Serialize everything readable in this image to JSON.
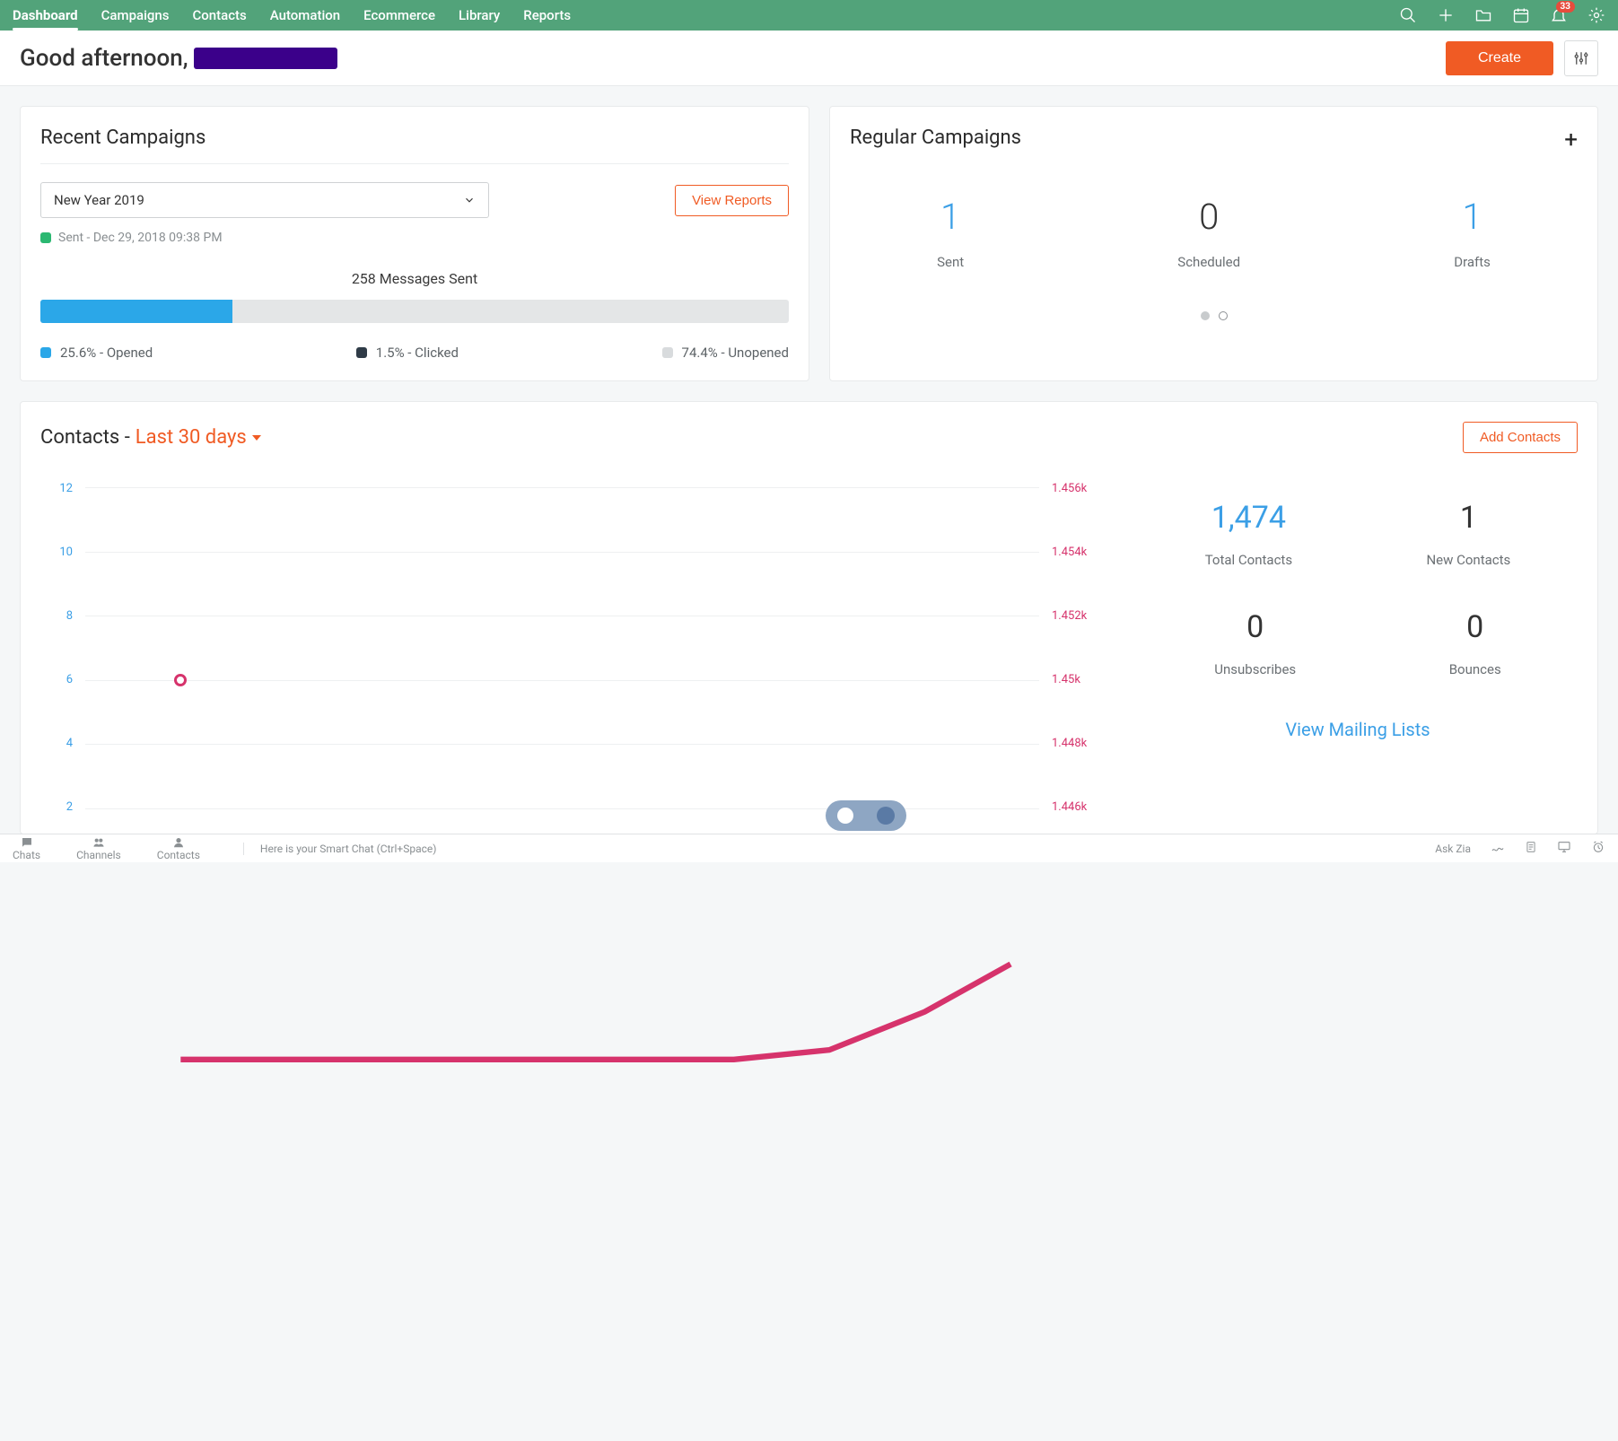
{
  "nav": {
    "items": [
      "Dashboard",
      "Campaigns",
      "Contacts",
      "Automation",
      "Ecommerce",
      "Library",
      "Reports"
    ],
    "active_index": 0
  },
  "notifications": {
    "count": "33"
  },
  "greeting": {
    "prefix": "Good afternoon,"
  },
  "actions": {
    "create": "Create"
  },
  "recent": {
    "title": "Recent Campaigns",
    "selected_campaign": "New Year 2019",
    "view_reports": "View Reports",
    "sent_status": "Sent - Dec 29, 2018 09:38 PM",
    "messages_sent": "258 Messages Sent",
    "legend": {
      "opened": "25.6% - Opened",
      "clicked": "1.5% - Clicked",
      "unopened": "74.4% - Unopened"
    }
  },
  "regular": {
    "title": "Regular Campaigns",
    "stats": [
      {
        "value": "1",
        "label": "Sent",
        "blue": true
      },
      {
        "value": "0",
        "label": "Scheduled",
        "blue": false
      },
      {
        "value": "1",
        "label": "Drafts",
        "blue": true
      }
    ]
  },
  "contacts": {
    "title_prefix": "Contacts -",
    "period": "Last 30 days",
    "add_button": "Add Contacts",
    "stats": {
      "total": {
        "value": "1,474",
        "label": "Total Contacts"
      },
      "new": {
        "value": "1",
        "label": "New Contacts"
      },
      "unsubs": {
        "value": "0",
        "label": "Unsubscribes"
      },
      "bounces": {
        "value": "0",
        "label": "Bounces"
      }
    },
    "view_mailing": "View Mailing Lists"
  },
  "chart_data": {
    "type": "line",
    "left_axis": {
      "ticks": [
        "12",
        "10",
        "8",
        "6",
        "4",
        "2"
      ],
      "color": "#3b9fe6"
    },
    "right_axis": {
      "ticks": [
        "1.456k",
        "1.454k",
        "1.452k",
        "1.45k",
        "1.448k",
        "1.446k"
      ],
      "color": "#d6336c"
    },
    "series": [
      {
        "name": "contacts",
        "axis": "right",
        "color": "#d6336c",
        "x": [
          0,
          1,
          2,
          3,
          4,
          5,
          6,
          7
        ],
        "y": [
          1.45,
          1.45,
          1.45,
          1.45,
          1.45,
          1.45,
          1.4505,
          1.451
        ]
      }
    ],
    "highlight_point": {
      "x": 0,
      "y": 1.45
    },
    "ylim_right": [
      1.446,
      1.456
    ]
  },
  "bottombar": {
    "tabs": [
      "Chats",
      "Channels",
      "Contacts"
    ],
    "smart_chat": "Here is your Smart Chat (Ctrl+Space)",
    "ask_zia": "Ask Zia"
  }
}
